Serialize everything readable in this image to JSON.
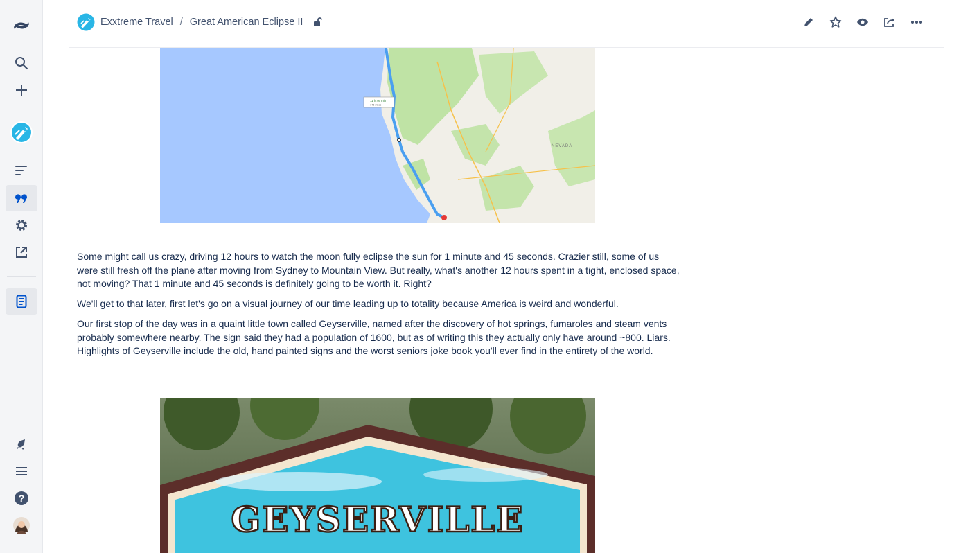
{
  "nav": {
    "items": [
      {
        "icon": "confluence-logo-icon"
      },
      {
        "icon": "search-icon"
      },
      {
        "icon": "create-icon"
      },
      {
        "icon": "space-avatar-icon"
      },
      {
        "icon": "pages-icon"
      },
      {
        "icon": "blog-icon"
      },
      {
        "icon": "space-settings-icon"
      },
      {
        "icon": "share-icon"
      },
      {
        "icon": "page-tree-icon"
      },
      {
        "icon": "notifications-icon"
      },
      {
        "icon": "menu-icon"
      },
      {
        "icon": "help-icon"
      },
      {
        "icon": "profile-avatar"
      }
    ],
    "accent": "#0052cc"
  },
  "breadcrumb": {
    "space": "Exxtreme Travel",
    "separator": "/",
    "page": "Great American Eclipse II"
  },
  "toolbar": {
    "icons": [
      "edit-icon",
      "star-icon",
      "watch-icon",
      "share-icon",
      "more-icon"
    ]
  },
  "map": {
    "route_label": "11 h 46 min",
    "route_sublabel": "745 miles",
    "region_label": "NEVADA"
  },
  "content": {
    "paragraphs": [
      "Some might call us crazy, driving 12 hours to watch the moon fully eclipse the sun for 1 minute and 45 seconds. Crazier still, some of us were still fresh off the plane after moving from Sydney to Mountain View. But really, what's another 12 hours spent in a tight, enclosed space, not moving? That 1 minute and 45 seconds is definitely going to be worth it. Right?",
      "We'll get to that later, first let's go on a visual journey of our time leading up to totality because America is weird and wonderful.",
      "Our first stop of the day was in a quaint little town called Geyserville, named after the discovery of hot springs, fumaroles and steam vents probably somewhere nearby. The sign said they had a population of 1600, but as of writing this they actually only have around ~800. Liars. Highlights of Geyserville include the old, hand painted signs and the worst seniors joke book you'll ever find in the entirety of the world."
    ]
  },
  "photo": {
    "sign_text": "GEYSERVILLE"
  }
}
